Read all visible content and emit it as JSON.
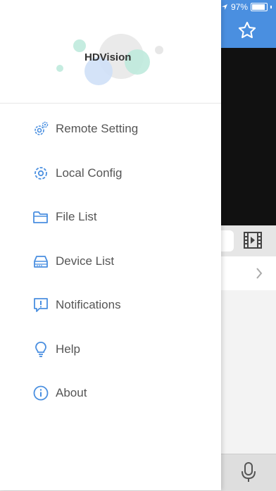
{
  "status_bar": {
    "battery": "97%"
  },
  "app": {
    "brand": "HDVision"
  },
  "menu": {
    "items": [
      {
        "label": "Remote Setting",
        "icon": "remote-setting-icon"
      },
      {
        "label": "Local Config",
        "icon": "gear-icon"
      },
      {
        "label": "File List",
        "icon": "folder-icon"
      },
      {
        "label": "Device List",
        "icon": "device-icon"
      },
      {
        "label": "Notifications",
        "icon": "notification-icon"
      },
      {
        "label": "Help",
        "icon": "bulb-icon"
      },
      {
        "label": "About",
        "icon": "info-icon"
      }
    ]
  },
  "colors": {
    "accent": "#4a8fe0",
    "icon": "#4a8fe0",
    "text": "#555555"
  }
}
